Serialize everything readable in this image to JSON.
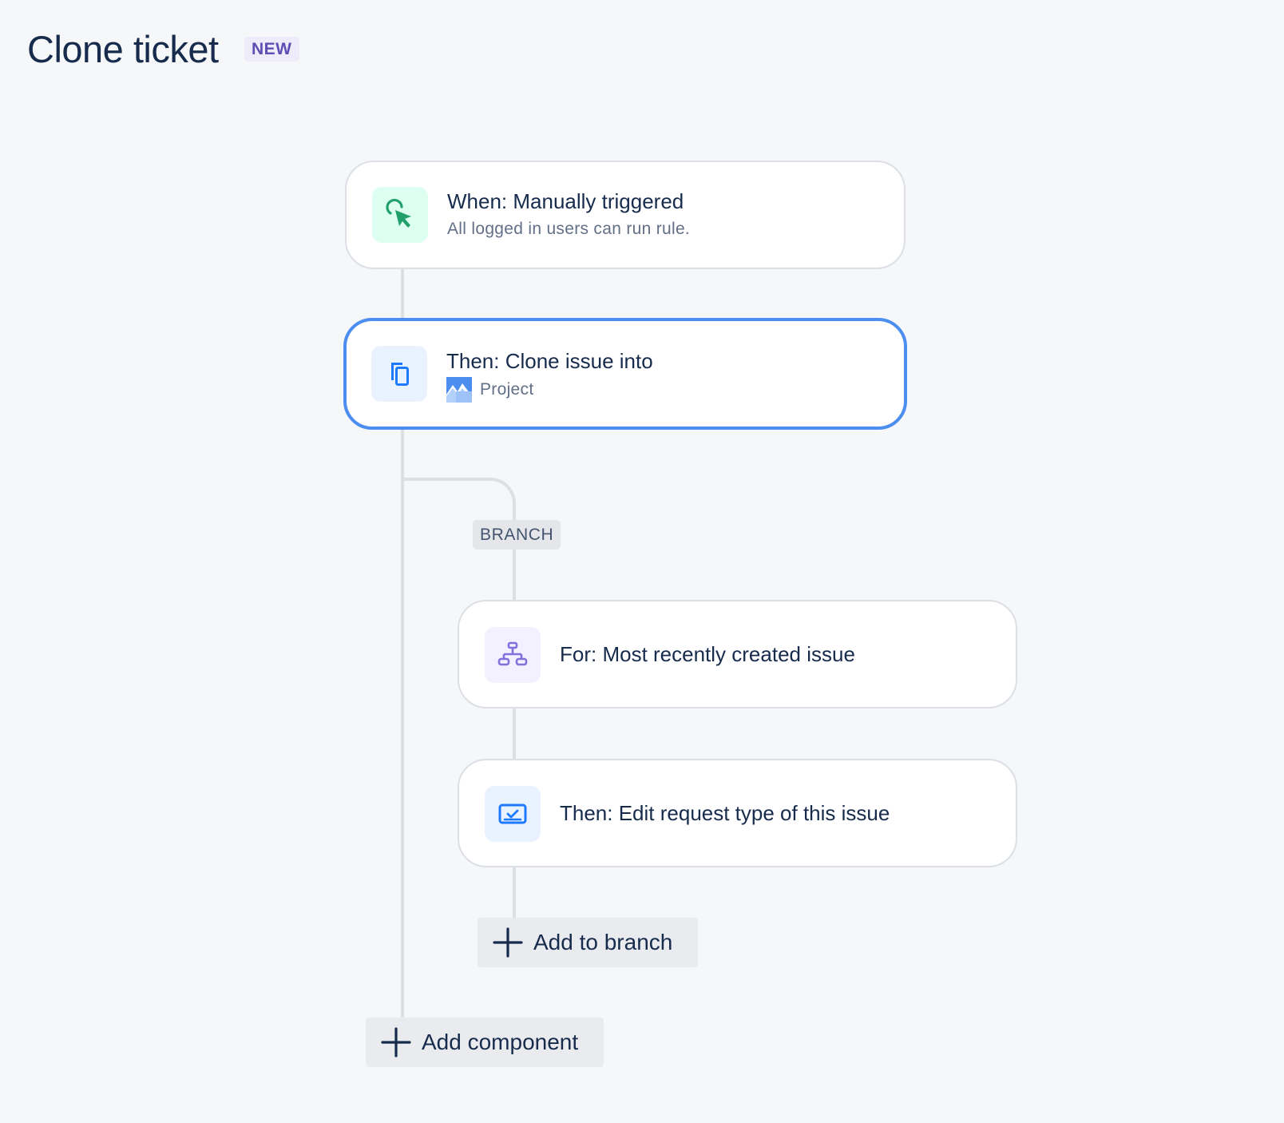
{
  "header": {
    "title": "Clone ticket",
    "badge": "NEW"
  },
  "flow": {
    "trigger": {
      "title": "When: Manually triggered",
      "subtitle": "All logged in users can run rule.",
      "icon": "cursor-click-icon"
    },
    "clone_action": {
      "title": "Then: Clone issue into",
      "project_label": "Project",
      "icon": "copy-icon",
      "project_icon": "project-avatar-icon",
      "selected": true
    },
    "branch": {
      "label": "BRANCH",
      "for_step": {
        "title": "For: Most recently created issue",
        "icon": "hierarchy-icon"
      },
      "edit_step": {
        "title": "Then: Edit request type of this issue",
        "icon": "request-type-icon"
      },
      "add_button": "Add to branch"
    },
    "add_component_button": "Add component"
  },
  "colors": {
    "accent": "#4c8df0",
    "trigger_icon": "#22a06b",
    "action_icon": "#1d7afc",
    "branch_icon": "#8270db",
    "badge_text": "#5e4db2"
  }
}
